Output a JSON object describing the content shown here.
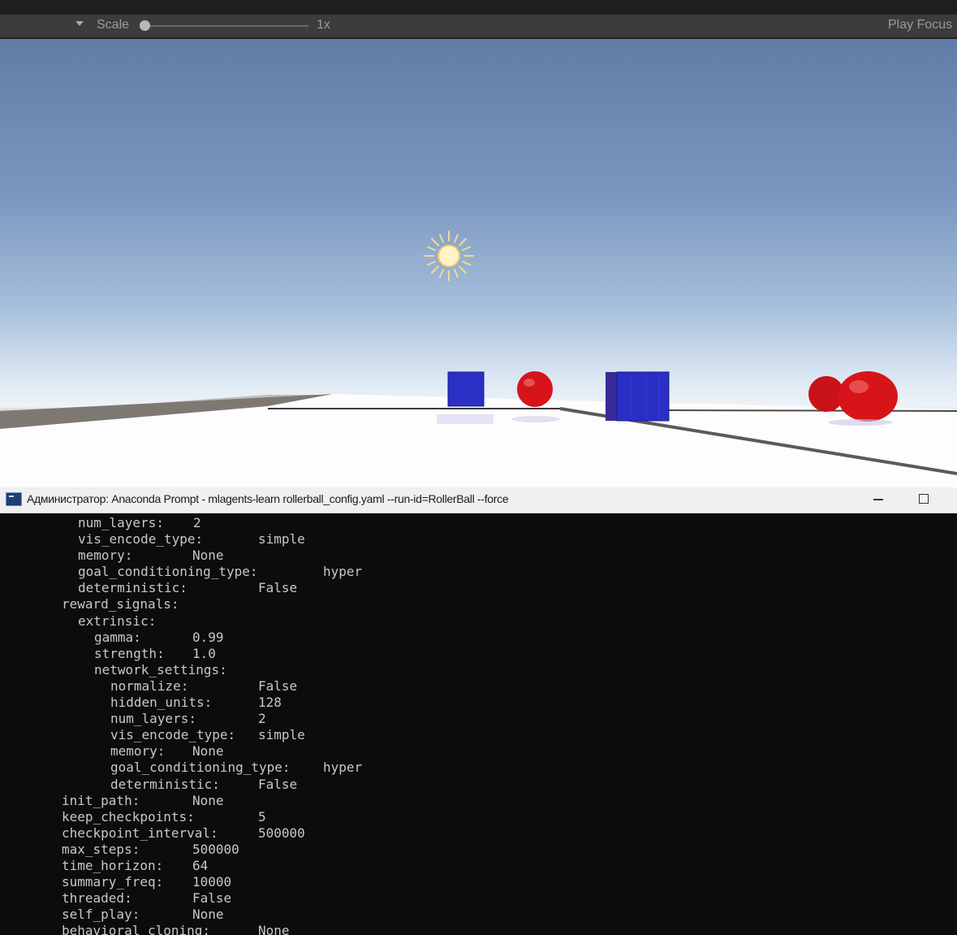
{
  "toolbar": {
    "dropdown_icon": "chevron-down-icon",
    "scale_label": "Scale",
    "scale_value": "1x",
    "play_focus_label": "Play Focus"
  },
  "viewport": {
    "sun_icon": "sun-icon",
    "colors": {
      "sky_top": "#617ca6",
      "horizon": "#eef3f7",
      "floor": "#ffffff",
      "cube": "#2b2fc4",
      "sphere": "#d4141a"
    }
  },
  "console": {
    "icon": "terminal-icon",
    "title": "Администратор: Anaconda Prompt - mlagents-learn  rollerball_config.yaml --run-id=RollerBall --force",
    "lines": [
      {
        "key": "num_layers:",
        "value": "2"
      },
      {
        "key": "vis_encode_type:",
        "value": "simple"
      },
      {
        "key": "memory:",
        "value": "None"
      },
      {
        "key": "goal_conditioning_type:",
        "value": "hyper"
      },
      {
        "key": "deterministic:",
        "value": "False"
      },
      {
        "key": "reward_signals:",
        "value": ""
      },
      {
        "key": "extrinsic:",
        "value": ""
      },
      {
        "key": "gamma:",
        "value": "0.99"
      },
      {
        "key": "strength:",
        "value": "1.0"
      },
      {
        "key": "network_settings:",
        "value": ""
      },
      {
        "key": "normalize:",
        "value": "False"
      },
      {
        "key": "hidden_units:",
        "value": "128"
      },
      {
        "key": "num_layers:",
        "value": "2"
      },
      {
        "key": "vis_encode_type:",
        "value": "simple"
      },
      {
        "key": "memory:",
        "value": "None"
      },
      {
        "key": "goal_conditioning_type:",
        "value": "hyper"
      },
      {
        "key": "deterministic:",
        "value": "False"
      },
      {
        "key": "init_path:",
        "value": "None"
      },
      {
        "key": "keep_checkpoints:",
        "value": "5"
      },
      {
        "key": "checkpoint_interval:",
        "value": "500000"
      },
      {
        "key": "max_steps:",
        "value": "500000"
      },
      {
        "key": "time_horizon:",
        "value": "64"
      },
      {
        "key": "summary_freq:",
        "value": "10000"
      },
      {
        "key": "threaded:",
        "value": "False"
      },
      {
        "key": "self_play:",
        "value": "None"
      },
      {
        "key": "behavioral_cloning:",
        "value": "None"
      }
    ]
  }
}
